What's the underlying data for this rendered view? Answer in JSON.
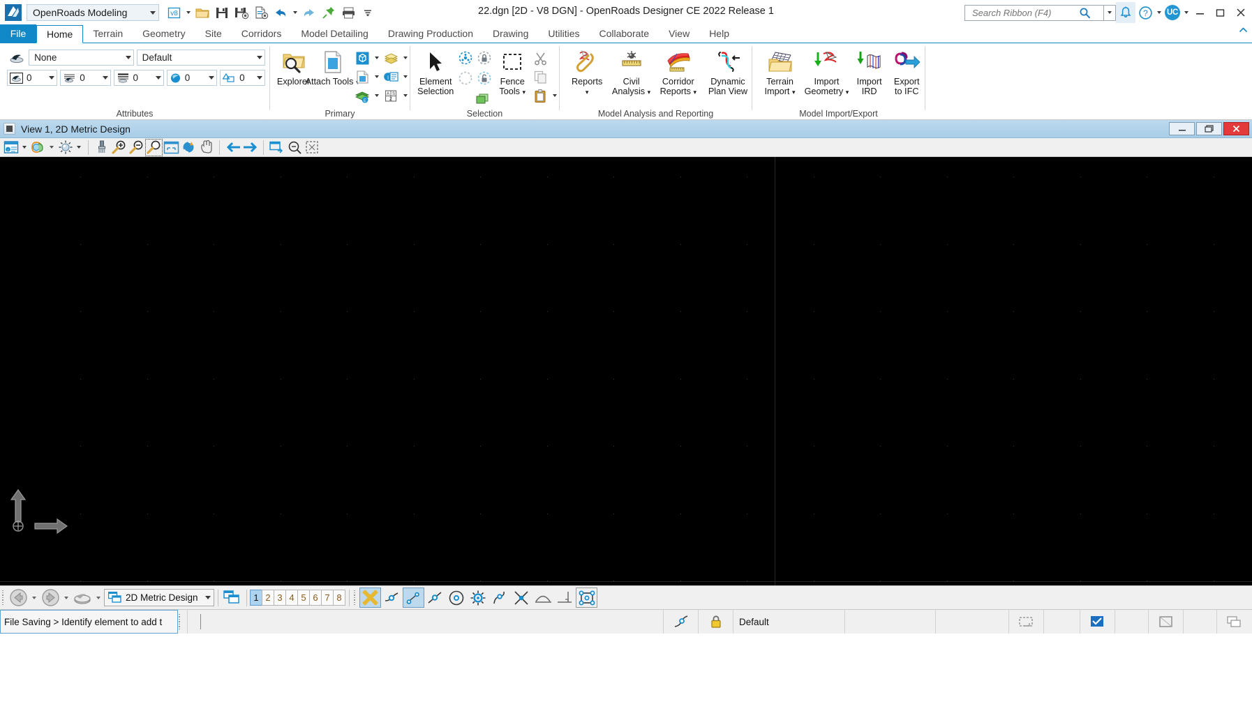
{
  "titlebar": {
    "app_logo": "bentley-logo-icon",
    "workflow": "OpenRoads Modeling",
    "document_title": "22.dgn [2D - V8 DGN] - OpenRoads Designer CE 2022 Release 1",
    "quick_access": [
      {
        "name": "v8-format-icon",
        "label": "V8"
      },
      {
        "name": "open-file-icon",
        "label": "Open"
      },
      {
        "name": "save-icon",
        "label": "Save"
      },
      {
        "name": "save-settings-icon",
        "label": "Save Settings"
      },
      {
        "name": "file-properties-icon",
        "label": "Properties"
      },
      {
        "name": "undo-icon",
        "label": "Undo"
      },
      {
        "name": "redo-icon",
        "label": "Redo"
      },
      {
        "name": "pin-icon",
        "label": "Pin"
      },
      {
        "name": "print-icon",
        "label": "Print"
      },
      {
        "name": "customize-qat-icon",
        "label": "Customize Quick Access Toolbar"
      }
    ],
    "search": {
      "placeholder": "Search Ribbon (F4)"
    },
    "notifications_icon": "bell-icon",
    "help_icon": "help-question-icon",
    "user_initials": "UC",
    "window_controls": {
      "minimize": "–",
      "restore": "❐",
      "close": "✕"
    }
  },
  "ribbon": {
    "tabs": [
      {
        "label": "File",
        "active": false,
        "is_file": true
      },
      {
        "label": "Home",
        "active": true
      },
      {
        "label": "Terrain",
        "active": false
      },
      {
        "label": "Geometry",
        "active": false
      },
      {
        "label": "Site",
        "active": false
      },
      {
        "label": "Corridors",
        "active": false
      },
      {
        "label": "Model Detailing",
        "active": false
      },
      {
        "label": "Drawing Production",
        "active": false
      },
      {
        "label": "Drawing",
        "active": false
      },
      {
        "label": "Utilities",
        "active": false
      },
      {
        "label": "Collaborate",
        "active": false
      },
      {
        "label": "View",
        "active": false
      },
      {
        "label": "Help",
        "active": false
      }
    ],
    "groups": {
      "attributes": {
        "label": "Attributes",
        "active_level_icon": "element-level-icon",
        "level": "None",
        "style": "Default",
        "color": "0",
        "linestyle": "0",
        "weight": "0",
        "transparency": "0",
        "priority": "0"
      },
      "primary": {
        "label": "Primary",
        "explorer": "Explorer",
        "attach_tools": "Attach Tools",
        "small_tools": [
          {
            "name": "models-icon"
          },
          {
            "name": "levels-display-icon"
          },
          {
            "name": "references-icon"
          },
          {
            "name": "element-information-icon"
          },
          {
            "name": "level-manager-icon"
          },
          {
            "name": "auxiliary-coordinates-icon"
          }
        ]
      },
      "selection": {
        "label": "Selection",
        "element_selection": "Element Selection",
        "fence_tools": "Fence Tools",
        "small_tools": [
          {
            "name": "select-all-icon"
          },
          {
            "name": "lock-icon"
          },
          {
            "name": "select-none-icon"
          },
          {
            "name": "unlock-icon"
          },
          {
            "name": "select-by-attributes-icon"
          },
          {
            "name": "cut-icon"
          },
          {
            "name": "copy-icon"
          },
          {
            "name": "paste-icon"
          }
        ]
      },
      "analysis": {
        "label": "Model Analysis and Reporting",
        "buttons": [
          {
            "label": "Reports",
            "icon": "reports-icon",
            "dropdown": true,
            "two_line": false
          },
          {
            "label": "Civil\nAnalysis",
            "icon": "civil-analysis-icon",
            "dropdown": true
          },
          {
            "label": "Corridor\nReports",
            "icon": "corridor-reports-icon",
            "dropdown": true
          },
          {
            "label": "Dynamic\nPlan View",
            "icon": "dynamic-plan-view-icon",
            "dropdown": false
          }
        ]
      },
      "import_export": {
        "label": "Model Import/Export",
        "buttons": [
          {
            "label": "Terrain\nImport",
            "icon": "terrain-import-icon",
            "dropdown": true
          },
          {
            "label": "Import\nGeometry",
            "icon": "import-geometry-icon",
            "dropdown": true
          },
          {
            "label": "Import\nIRD",
            "icon": "import-ird-icon",
            "dropdown": false
          },
          {
            "label": "Export\nto IFC",
            "icon": "export-to-ifc-icon",
            "dropdown": false
          }
        ]
      }
    }
  },
  "view_window": {
    "title": "View 1, 2D Metric Design",
    "window_icon": "view-window-icon",
    "controls": {
      "minimize": "–",
      "restore": "❐",
      "close": "✕"
    },
    "toolbar": [
      {
        "name": "view-attributes-icon"
      },
      {
        "name": "view-attributes-dropdown"
      },
      {
        "name": "view-display-mode-icon"
      },
      {
        "name": "view-brightness-icon"
      },
      {
        "name": "view-display-dropdown"
      },
      {
        "name": "clear-view-icon"
      },
      {
        "name": "zoom-in-icon"
      },
      {
        "name": "zoom-out-icon"
      },
      {
        "name": "window-area-icon"
      },
      {
        "name": "fit-view-icon"
      },
      {
        "name": "rotate-view-icon"
      },
      {
        "name": "pan-view-icon"
      },
      {
        "name": "view-previous-icon"
      },
      {
        "name": "view-next-icon"
      },
      {
        "name": "copy-view-icon"
      },
      {
        "name": "clip-volume-icon"
      },
      {
        "name": "clip-mask-icon"
      }
    ]
  },
  "bottom_bar": {
    "nav_back_icon": "back-arrow-icon",
    "nav_forward_icon": "forward-arrow-icon",
    "model_browse_icon": "model-browse-icon",
    "model_name": "2D Metric Design",
    "view_groups_icon": "view-groups-icon",
    "view_numbers": [
      "1",
      "2",
      "3",
      "4",
      "5",
      "6",
      "7",
      "8"
    ],
    "active_view": "1",
    "snaps": [
      {
        "name": "snap-none-icon",
        "active": true
      },
      {
        "name": "snap-nearest-icon",
        "active": false
      },
      {
        "name": "snap-keypoint-icon",
        "active": true
      },
      {
        "name": "snap-midpoint-icon",
        "active": false
      },
      {
        "name": "snap-center-icon",
        "active": false
      },
      {
        "name": "snap-origin-icon",
        "active": false
      },
      {
        "name": "snap-bisector-icon",
        "active": false
      },
      {
        "name": "snap-intersection-icon",
        "active": false
      },
      {
        "name": "snap-tangent-icon",
        "active": false
      },
      {
        "name": "snap-perpendicular-icon",
        "active": false
      },
      {
        "name": "snap-point-on-icon",
        "active": false
      }
    ]
  },
  "status_bar": {
    "message": "File Saving > Identify element to add t",
    "level_lock_icon": "lock-closed-icon",
    "element_tool_icon": "element-tool-icon",
    "active_level": "Default",
    "right_icons": [
      {
        "name": "snap-mode-status-icon"
      },
      {
        "name": "selection-set-status-icon"
      },
      {
        "name": "fence-status-icon"
      },
      {
        "name": "model-status-icon"
      }
    ]
  }
}
